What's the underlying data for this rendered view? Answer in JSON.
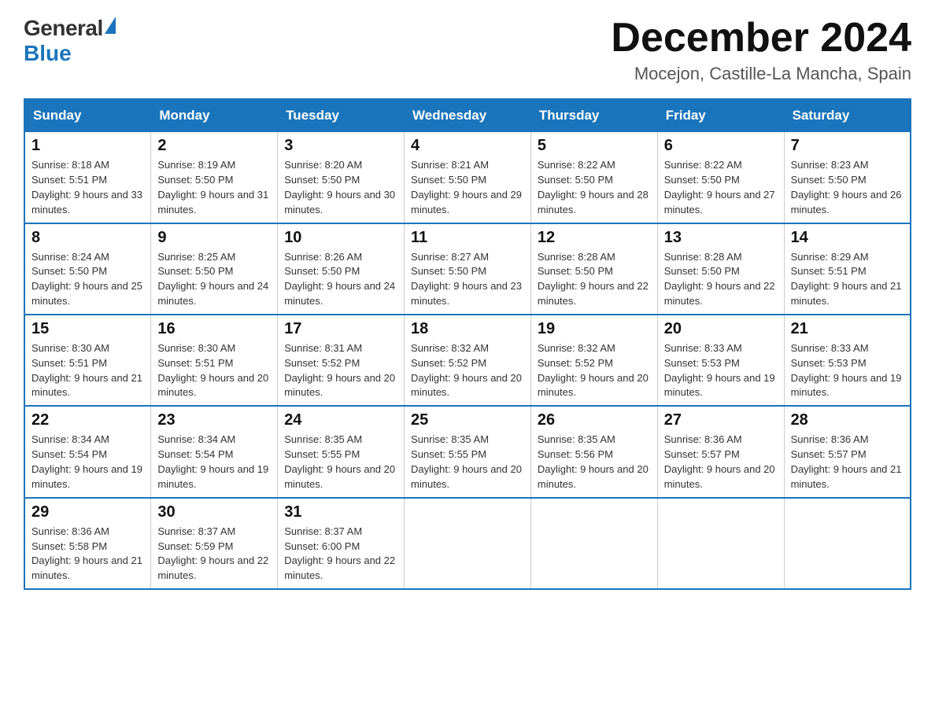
{
  "header": {
    "logo_general": "General",
    "logo_blue": "Blue",
    "month_title": "December 2024",
    "location": "Mocejon, Castille-La Mancha, Spain"
  },
  "days_of_week": [
    "Sunday",
    "Monday",
    "Tuesday",
    "Wednesday",
    "Thursday",
    "Friday",
    "Saturday"
  ],
  "weeks": [
    [
      {
        "day": "1",
        "sunrise": "8:18 AM",
        "sunset": "5:51 PM",
        "daylight": "9 hours and 33 minutes."
      },
      {
        "day": "2",
        "sunrise": "8:19 AM",
        "sunset": "5:50 PM",
        "daylight": "9 hours and 31 minutes."
      },
      {
        "day": "3",
        "sunrise": "8:20 AM",
        "sunset": "5:50 PM",
        "daylight": "9 hours and 30 minutes."
      },
      {
        "day": "4",
        "sunrise": "8:21 AM",
        "sunset": "5:50 PM",
        "daylight": "9 hours and 29 minutes."
      },
      {
        "day": "5",
        "sunrise": "8:22 AM",
        "sunset": "5:50 PM",
        "daylight": "9 hours and 28 minutes."
      },
      {
        "day": "6",
        "sunrise": "8:22 AM",
        "sunset": "5:50 PM",
        "daylight": "9 hours and 27 minutes."
      },
      {
        "day": "7",
        "sunrise": "8:23 AM",
        "sunset": "5:50 PM",
        "daylight": "9 hours and 26 minutes."
      }
    ],
    [
      {
        "day": "8",
        "sunrise": "8:24 AM",
        "sunset": "5:50 PM",
        "daylight": "9 hours and 25 minutes."
      },
      {
        "day": "9",
        "sunrise": "8:25 AM",
        "sunset": "5:50 PM",
        "daylight": "9 hours and 24 minutes."
      },
      {
        "day": "10",
        "sunrise": "8:26 AM",
        "sunset": "5:50 PM",
        "daylight": "9 hours and 24 minutes."
      },
      {
        "day": "11",
        "sunrise": "8:27 AM",
        "sunset": "5:50 PM",
        "daylight": "9 hours and 23 minutes."
      },
      {
        "day": "12",
        "sunrise": "8:28 AM",
        "sunset": "5:50 PM",
        "daylight": "9 hours and 22 minutes."
      },
      {
        "day": "13",
        "sunrise": "8:28 AM",
        "sunset": "5:50 PM",
        "daylight": "9 hours and 22 minutes."
      },
      {
        "day": "14",
        "sunrise": "8:29 AM",
        "sunset": "5:51 PM",
        "daylight": "9 hours and 21 minutes."
      }
    ],
    [
      {
        "day": "15",
        "sunrise": "8:30 AM",
        "sunset": "5:51 PM",
        "daylight": "9 hours and 21 minutes."
      },
      {
        "day": "16",
        "sunrise": "8:30 AM",
        "sunset": "5:51 PM",
        "daylight": "9 hours and 20 minutes."
      },
      {
        "day": "17",
        "sunrise": "8:31 AM",
        "sunset": "5:52 PM",
        "daylight": "9 hours and 20 minutes."
      },
      {
        "day": "18",
        "sunrise": "8:32 AM",
        "sunset": "5:52 PM",
        "daylight": "9 hours and 20 minutes."
      },
      {
        "day": "19",
        "sunrise": "8:32 AM",
        "sunset": "5:52 PM",
        "daylight": "9 hours and 20 minutes."
      },
      {
        "day": "20",
        "sunrise": "8:33 AM",
        "sunset": "5:53 PM",
        "daylight": "9 hours and 19 minutes."
      },
      {
        "day": "21",
        "sunrise": "8:33 AM",
        "sunset": "5:53 PM",
        "daylight": "9 hours and 19 minutes."
      }
    ],
    [
      {
        "day": "22",
        "sunrise": "8:34 AM",
        "sunset": "5:54 PM",
        "daylight": "9 hours and 19 minutes."
      },
      {
        "day": "23",
        "sunrise": "8:34 AM",
        "sunset": "5:54 PM",
        "daylight": "9 hours and 19 minutes."
      },
      {
        "day": "24",
        "sunrise": "8:35 AM",
        "sunset": "5:55 PM",
        "daylight": "9 hours and 20 minutes."
      },
      {
        "day": "25",
        "sunrise": "8:35 AM",
        "sunset": "5:55 PM",
        "daylight": "9 hours and 20 minutes."
      },
      {
        "day": "26",
        "sunrise": "8:35 AM",
        "sunset": "5:56 PM",
        "daylight": "9 hours and 20 minutes."
      },
      {
        "day": "27",
        "sunrise": "8:36 AM",
        "sunset": "5:57 PM",
        "daylight": "9 hours and 20 minutes."
      },
      {
        "day": "28",
        "sunrise": "8:36 AM",
        "sunset": "5:57 PM",
        "daylight": "9 hours and 21 minutes."
      }
    ],
    [
      {
        "day": "29",
        "sunrise": "8:36 AM",
        "sunset": "5:58 PM",
        "daylight": "9 hours and 21 minutes."
      },
      {
        "day": "30",
        "sunrise": "8:37 AM",
        "sunset": "5:59 PM",
        "daylight": "9 hours and 22 minutes."
      },
      {
        "day": "31",
        "sunrise": "8:37 AM",
        "sunset": "6:00 PM",
        "daylight": "9 hours and 22 minutes."
      },
      null,
      null,
      null,
      null
    ]
  ]
}
